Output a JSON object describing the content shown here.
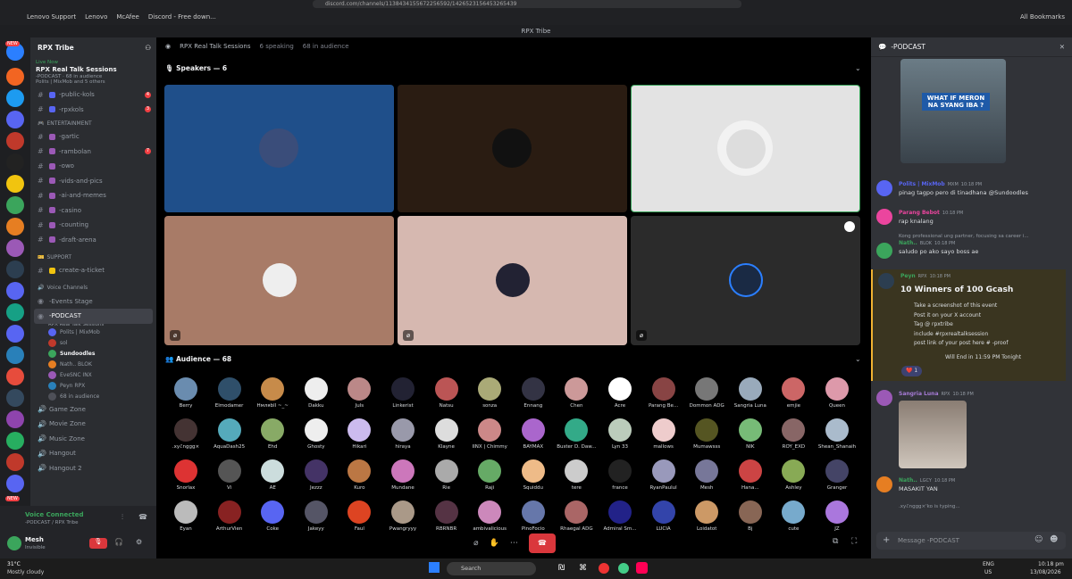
{
  "browser": {
    "url": "discord.com/channels/1138434155672256592/1426523156453265439",
    "bookmarks": [
      "Lenovo Support",
      "Lenovo",
      "McAfee",
      "Discord - Free down..."
    ],
    "all_bookmarks": "All Bookmarks"
  },
  "app": {
    "title": "RPX Tribe"
  },
  "server": {
    "name": "RPX Tribe",
    "live_now": "Live Now",
    "live_title": "RPX Real Talk Sessions",
    "live_sub": "-PODCAST · 68 in audience",
    "live_sub2": "Polits | MixMob and 5 others",
    "channels_top": [
      {
        "name": "-public-kols",
        "badge": "4"
      },
      {
        "name": "-rpxkols",
        "badge": "3"
      }
    ],
    "cat_entertainment": "ENTERTAINMENT",
    "channels_ent": [
      {
        "name": "-gartic",
        "badge": ""
      },
      {
        "name": "-rambolan",
        "badge": "7"
      },
      {
        "name": "-owo",
        "badge": ""
      },
      {
        "name": "-vids-and-pics",
        "badge": ""
      },
      {
        "name": "-ai-and-memes",
        "badge": ""
      },
      {
        "name": "-casino",
        "badge": ""
      },
      {
        "name": "-counting",
        "badge": ""
      },
      {
        "name": "-draft-arena",
        "badge": ""
      }
    ],
    "cat_support": "SUPPORT",
    "create_ticket": "create-a-ticket",
    "cat_voice": "Voice Channels",
    "events_stage": "-Events Stage",
    "podcast": "-PODCAST",
    "podcast_sub": "RPX Real Talk Sessions",
    "voice_members": [
      "Polits | MixMob",
      "sol",
      "Sundoodles",
      "Nath.. BLOK",
      "EveSNC INX",
      "Peyn RPX"
    ],
    "in_audience": "68 in audience",
    "voice_channels": [
      "Game Zone",
      "Movie Zone",
      "Music Zone",
      "Hangout",
      "Hangout 2"
    ]
  },
  "voice": {
    "connected": "Voice Connected",
    "where": "-PODCAST / RPX Tribe",
    "user": "Mesh",
    "status": "Invisible"
  },
  "stage": {
    "title": "RPX Real Talk Sessions",
    "speaking": "6 speaking",
    "audience_count": "68 in audience",
    "speakers_label": "Speakers — 6",
    "audience_label": "Audience — 68",
    "speaker_colors": [
      "#1f4f8a",
      "#2a1c12",
      "#e3e3e3",
      "#a87b67",
      "#d6b8b0",
      "#2b2b2b"
    ],
    "audience": [
      "Berry",
      "Elmodamer",
      "Hмляbll ~_~",
      "Dakku",
      "Juls",
      "Linkerist",
      "Natsu",
      "sonza",
      "Ennang",
      "Chen",
      "Acre",
      "Parang Be...",
      "Dommon ADG",
      "Sangria Luna",
      "emjie",
      "Queen",
      ".xyℰnggg×",
      "AquaDash25",
      "Ehd",
      "Ghosty",
      "Hikari",
      "hiraya",
      "Klayne",
      "IINX | Chimmy",
      "BAYMAX",
      "Buster D. Daw...",
      "Lyn 33",
      "mallows",
      "Mumawsss",
      "NIK",
      "ROY_EXD",
      "Shean_Shanaih",
      "Snorlax",
      "Vi",
      "AE",
      "Jezzz",
      "Kuro",
      "Mundane",
      "Rie",
      "Raji",
      "Squiddu",
      "tere",
      "france",
      "RyanPaulul",
      "Mesh",
      "Hana...",
      "Ashley",
      "Granger",
      "Eyan",
      "ArthurVien",
      "Coke",
      "Jakeyy",
      "Faul",
      "Pwangryyy",
      "RBRNBR",
      "ambivalicious",
      "PinoFocio",
      "Rhaegal ADG",
      "Admiral Sm...",
      "LUCIA",
      "Loidatot",
      "Bj",
      "cute",
      "JZ"
    ],
    "audience_colors": [
      "#6a8caf",
      "#2f4f6a",
      "#c78b4a",
      "#eee",
      "#b88",
      "#223",
      "#b55",
      "#aa7",
      "#334",
      "#c99",
      "#fff",
      "#844",
      "#777",
      "#9ab",
      "#c66",
      "#d9a",
      "#433",
      "#5ab",
      "#8a6",
      "#eee",
      "#cbe",
      "#99a",
      "#ddd",
      "#c88",
      "#a6c",
      "#3a8",
      "#bcb",
      "#ecc",
      "#552",
      "#7b7",
      "#866",
      "#abc",
      "#d33",
      "#555",
      "#cdd",
      "#436",
      "#b74",
      "#c7b",
      "#aaa",
      "#6a6",
      "#eb8",
      "#ccc",
      "#222",
      "#99b",
      "#779",
      "#c44",
      "#8a5",
      "#446",
      "#bbb",
      "#822",
      "#5865f2",
      "#556",
      "#d42",
      "#a98",
      "#534",
      "#c8b",
      "#67a",
      "#a66",
      "#228",
      "#34a",
      "#c96",
      "#865",
      "#7ac",
      "#a7d"
    ]
  },
  "chat": {
    "channel": "-PODCAST",
    "image_text": "WHAT IF MERON NA SYANG IBA ?",
    "messages": [
      {
        "user": "Polits | MixMob",
        "tag": "MXM",
        "time": "10:18 PM",
        "text": "pinag tagpo pero di tinadhana @Sundoodles",
        "color": "#5865f2"
      },
      {
        "user": "Parang Bebot",
        "tag": "",
        "time": "10:18 PM",
        "text": "rap knalang",
        "color": "#eb459e"
      },
      {
        "user": "Nath..",
        "tag": "BLOK",
        "time": "10:18 PM",
        "text": "saludo po ako sayo boss ae",
        "color": "#3ba55c",
        "reply": "Kong professional ung partner, focusing sa career i..."
      },
      {
        "user": "Peyn",
        "tag": "RPX",
        "time": "10:18 PM",
        "text": "",
        "color": "#3ba55c"
      }
    ],
    "giveaway": {
      "title": "10 Winners of 100 Gcash",
      "lines": [
        "Take a screenshot of this event",
        "Post it on your X account",
        "Tag @ rpxtribe",
        "include #rpxrealtalksession",
        "post link of your post here #  -proof"
      ],
      "ends": "Will End in 11:59 PM Tonight",
      "reaction": "1"
    },
    "msg5": {
      "user": "Sangria Luna",
      "tag": "RPX",
      "time": "10:18 PM"
    },
    "msg6": {
      "user": "Nath..",
      "tag": "LGCY",
      "time": "10:18 PM",
      "text": "MASAKIT YAN"
    },
    "typing": ".xyℰnggg×'ko is typing...",
    "input_placeholder": "Message  -PODCAST"
  },
  "taskbar": {
    "weather_temp": "31°C",
    "weather": "Mostly cloudy",
    "search": "Search",
    "lang": "ENG",
    "lang2": "US",
    "time": "10:18 pm",
    "date": "13/08/2026"
  }
}
